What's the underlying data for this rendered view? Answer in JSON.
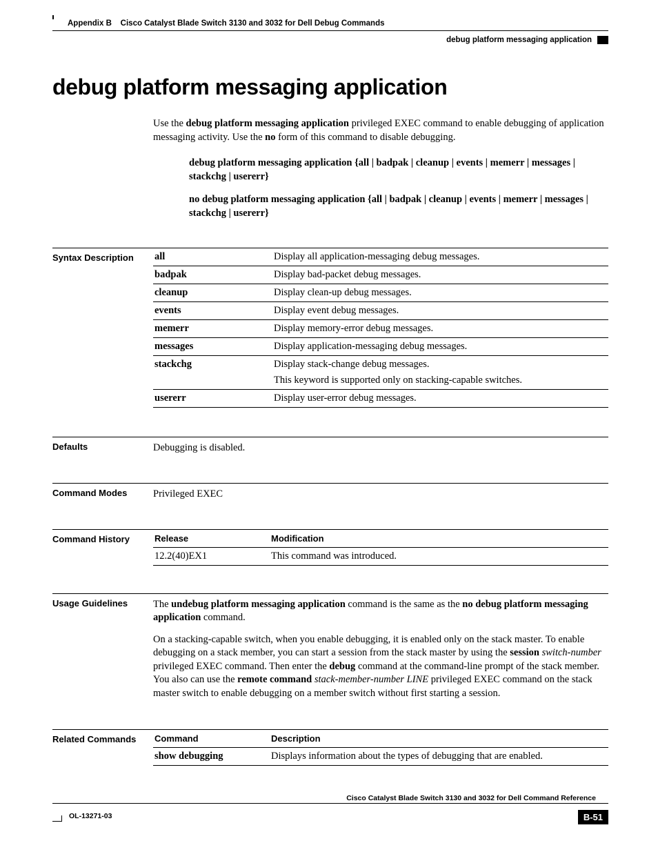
{
  "header": {
    "appendix": "Appendix B",
    "chapter": "Cisco Catalyst Blade Switch 3130 and 3032 for Dell Debug Commands",
    "command": "debug platform messaging application"
  },
  "title": "debug platform messaging application",
  "intro": {
    "pre": "Use the ",
    "cmd_bold": "debug platform messaging application",
    "mid": " privileged EXEC command to enable debugging of application messaging activity. Use the ",
    "no_bold": "no",
    "post": " form of this command to disable debugging."
  },
  "syntax": {
    "line1": "debug platform messaging application {all | badpak | cleanup | events | memerr | messages | stackchg | usererr}",
    "line2": "no debug platform messaging application {all | badpak | cleanup | events | memerr | messages | stackchg | usererr}"
  },
  "sections": {
    "syntax_desc": "Syntax Description",
    "defaults": "Defaults",
    "cmd_modes": "Command Modes",
    "cmd_history": "Command History",
    "usage": "Usage Guidelines",
    "related": "Related Commands"
  },
  "syntax_table": [
    {
      "kw": "all",
      "desc": "Display all application-messaging debug messages."
    },
    {
      "kw": "badpak",
      "desc": "Display bad-packet debug messages."
    },
    {
      "kw": "cleanup",
      "desc": "Display clean-up debug messages."
    },
    {
      "kw": "events",
      "desc": "Display event debug messages."
    },
    {
      "kw": "memerr",
      "desc": "Display memory-error debug messages."
    },
    {
      "kw": "messages",
      "desc": "Display application-messaging debug messages."
    },
    {
      "kw": "stackchg",
      "desc": "Display stack-change debug messages.",
      "note": "This keyword is supported only on stacking-capable switches."
    },
    {
      "kw": "usererr",
      "desc": "Display user-error debug messages."
    }
  ],
  "defaults": "Debugging is disabled.",
  "command_modes": "Privileged EXEC",
  "history": {
    "h1": "Release",
    "h2": "Modification",
    "release": "12.2(40)EX1",
    "modification": "This command was introduced."
  },
  "usage_para1": {
    "pre": "The ",
    "b1": "undebug platform messaging application",
    "mid": " command is the same as the ",
    "b2": "no debug platform messaging application",
    "post": " command."
  },
  "usage_para2": {
    "t1": "On a stacking-capable switch, when you enable debugging, it is enabled only on the stack master. To enable debugging on a stack member, you can start a session from the stack master by using the ",
    "b1": "session",
    "t2": " ",
    "i1": "switch-number",
    "t3": " privileged EXEC command. Then enter the ",
    "b2": "debug",
    "t4": " command at the command-line prompt of the stack member. You also can use the ",
    "b3": "remote command",
    "t5": " ",
    "i2": "stack-member-number LINE",
    "t6": " privileged EXEC command on the stack master switch to enable debugging on a member switch without first starting a session."
  },
  "related": {
    "h1": "Command",
    "h2": "Description",
    "cmd": "show debugging",
    "desc": "Displays information about the types of debugging that are enabled."
  },
  "footer": {
    "title": "Cisco Catalyst Blade Switch 3130 and 3032 for Dell Command Reference",
    "docnum": "OL-13271-03",
    "page": "B-51"
  }
}
